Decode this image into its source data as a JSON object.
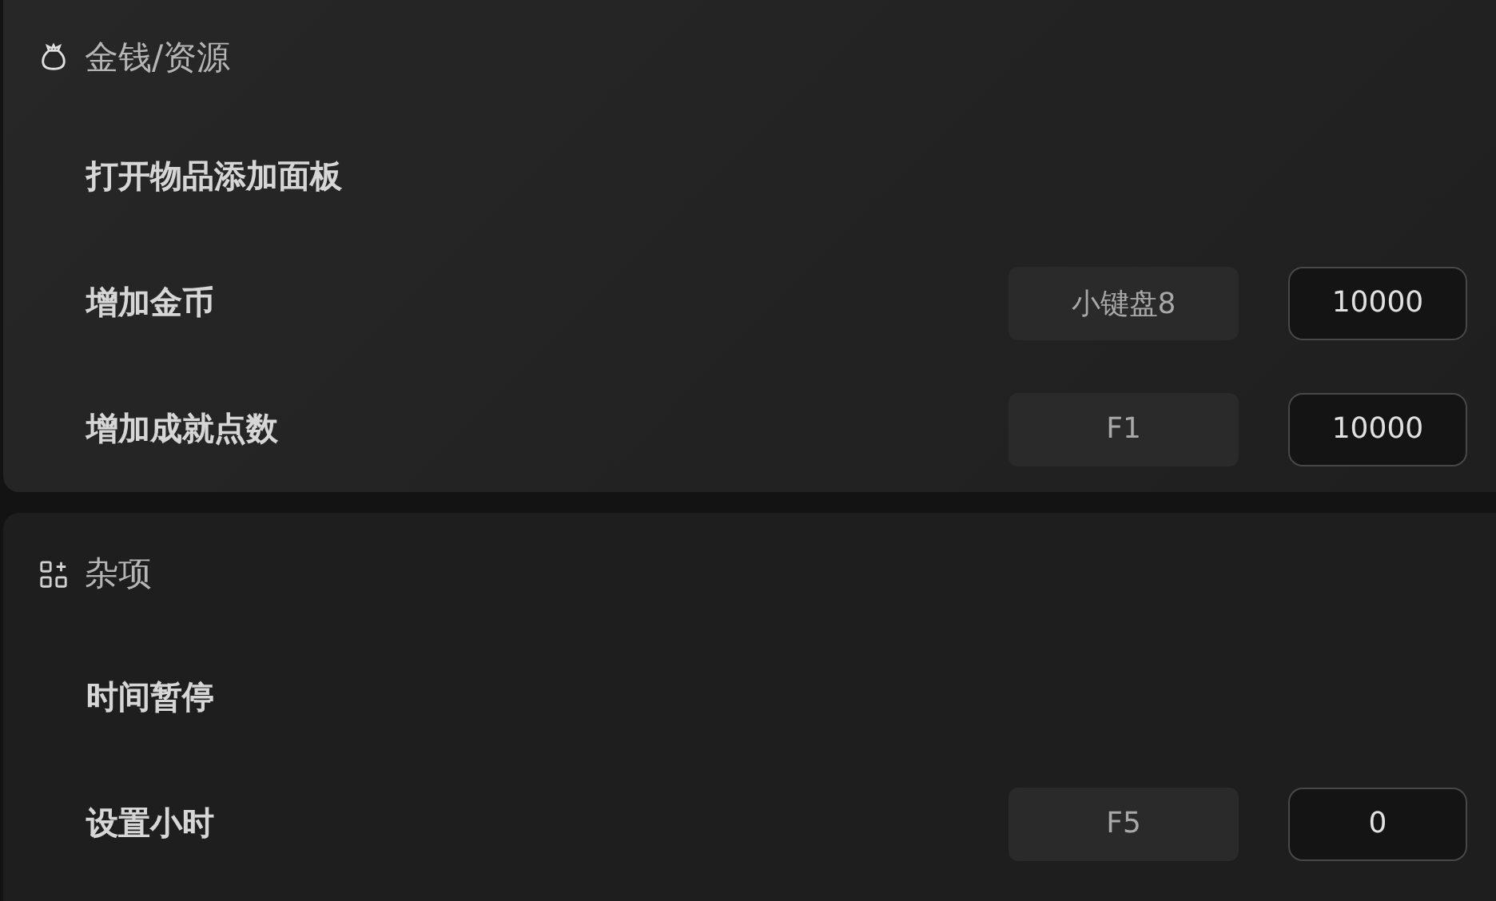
{
  "sections": [
    {
      "title": "金钱/资源",
      "kind": "bag",
      "rows": [
        {
          "label": "打开物品添加面板"
        },
        {
          "label": "增加金币",
          "hotkey": "小键盘8",
          "value": "10000"
        },
        {
          "label": "增加成就点数",
          "hotkey": "F1",
          "value": "10000"
        }
      ]
    },
    {
      "title": "杂项",
      "kind": "grid",
      "rows": [
        {
          "label": "时间暂停"
        },
        {
          "label": "设置小时",
          "hotkey": "F5",
          "value": "0"
        }
      ]
    }
  ]
}
